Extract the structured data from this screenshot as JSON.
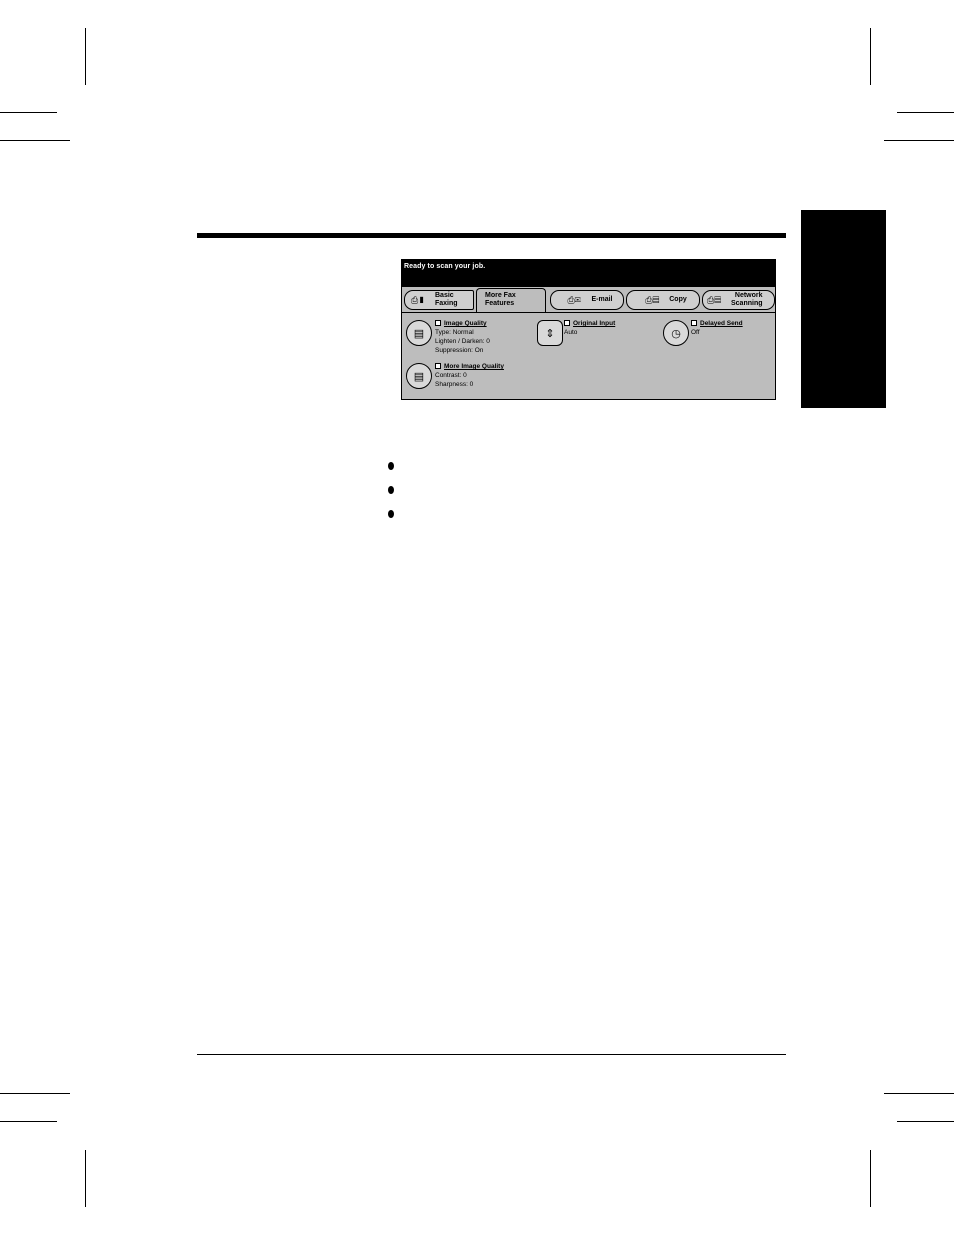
{
  "screen": {
    "status": "Ready to scan your job.",
    "tabs": {
      "basic": {
        "line1": "Basic",
        "line2": "Faxing"
      },
      "more": {
        "line1": "More Fax",
        "line2": "Features"
      },
      "email": {
        "label": "E-mail"
      },
      "copy": {
        "label": "Copy"
      },
      "network": {
        "line1": "Network",
        "line2": "Scanning"
      }
    },
    "features": {
      "image_quality": {
        "title": "Image Quality",
        "line1": "Type: Normal",
        "line2": "Lighten / Darken: 0",
        "line3": "Suppression: On"
      },
      "more_image_quality": {
        "title": "More Image Quality",
        "line1": "Contrast: 0",
        "line2": "Sharpness: 0"
      },
      "original_input": {
        "title": "Original Input",
        "line1": "Auto"
      },
      "delayed_send": {
        "title": "Delayed Send",
        "line1": "Off"
      }
    }
  },
  "icons": [
    "fax-icon",
    "image-quality-icon",
    "original-input-icon",
    "clock-icon",
    "email-icon",
    "copy-icon",
    "network-icon"
  ]
}
